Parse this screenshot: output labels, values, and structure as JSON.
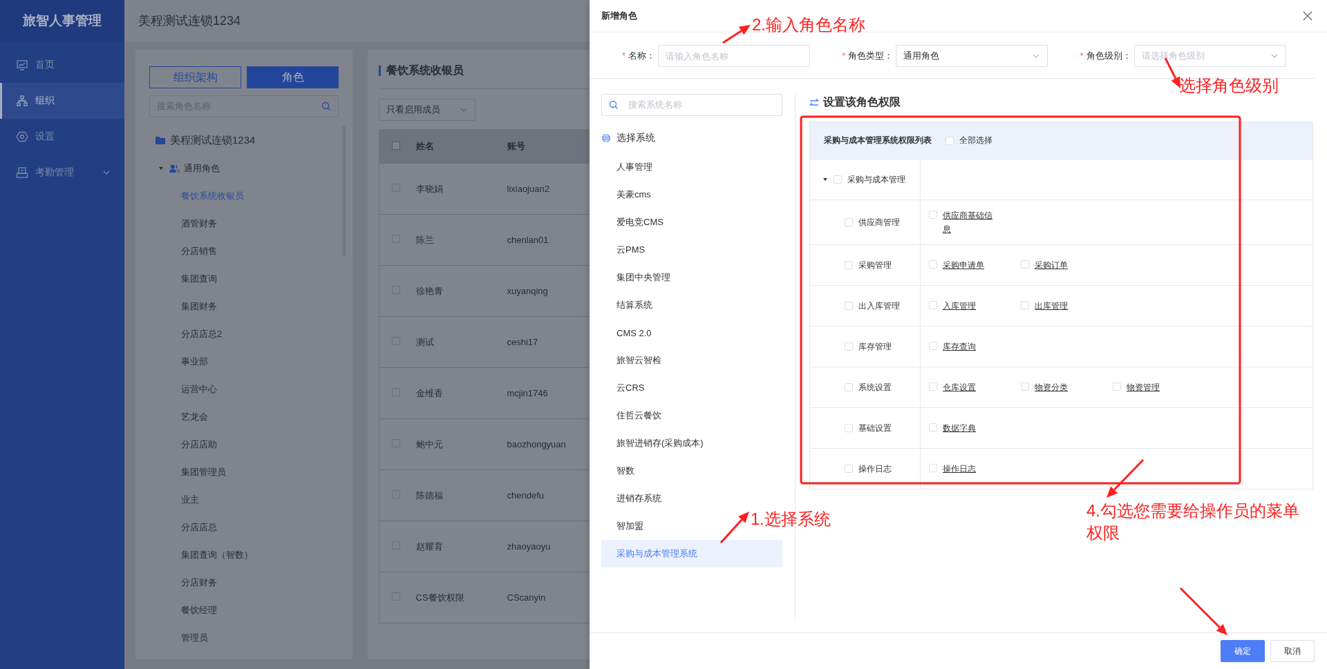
{
  "sidebar": {
    "logo": "旅智人事管理",
    "items": [
      {
        "label": "首页",
        "kind": "link",
        "selected": false
      },
      {
        "label": "组织",
        "kind": "link",
        "selected": true
      },
      {
        "label": "设置",
        "kind": "link",
        "selected": false
      },
      {
        "label": "考勤管理",
        "kind": "group",
        "selected": false
      }
    ]
  },
  "header": {
    "title": "美程测试连锁1234"
  },
  "org_panel": {
    "tabs": [
      {
        "label": "组织架构",
        "selected": false
      },
      {
        "label": "角色",
        "selected": true
      }
    ],
    "search": {
      "placeholder": "搜索角色名称"
    },
    "tree": {
      "label": "美程测试连锁1234",
      "children": [
        {
          "label": "通用角色",
          "expanded": true,
          "children": [
            {
              "label": "餐饮系统收银员",
              "selected": true
            },
            {
              "label": "酒管财务",
              "selected": false
            },
            {
              "label": "分店销售",
              "selected": false
            },
            {
              "label": "集团查询",
              "selected": false
            },
            {
              "label": "集团财务",
              "selected": false
            },
            {
              "label": "分店店总2",
              "selected": false
            },
            {
              "label": "事业部",
              "selected": false
            },
            {
              "label": "运营中心",
              "selected": false
            },
            {
              "label": "艺龙会",
              "selected": false
            },
            {
              "label": "分店店助",
              "selected": false
            },
            {
              "label": "集团管理员",
              "selected": false
            },
            {
              "label": "业主",
              "selected": false
            },
            {
              "label": "分店店总",
              "selected": false
            },
            {
              "label": "集团查询（智数）",
              "selected": false
            },
            {
              "label": "分店财务",
              "selected": false
            },
            {
              "label": "餐饮经理",
              "selected": false
            },
            {
              "label": "管理员",
              "selected": false
            }
          ]
        }
      ]
    }
  },
  "members_panel": {
    "title": "餐饮系统收银员",
    "filter": {
      "value": "只看启用成员"
    },
    "table": {
      "all_checked": false,
      "columns": [
        "姓名",
        "账号"
      ],
      "rows": [
        {
          "checked": false,
          "cells": [
            "李晓娟",
            "lixiaojuan2"
          ]
        },
        {
          "checked": false,
          "cells": [
            "陈兰",
            "chenlan01"
          ]
        },
        {
          "checked": false,
          "cells": [
            "徐艳青",
            "xuyanqing"
          ]
        },
        {
          "checked": false,
          "cells": [
            "测试",
            "ceshi17"
          ]
        },
        {
          "checked": false,
          "cells": [
            "金维香",
            "mcjin1746"
          ]
        },
        {
          "checked": false,
          "cells": [
            "鲍中元",
            "baozhongyuan"
          ]
        },
        {
          "checked": false,
          "cells": [
            "陈德福",
            "chendefu"
          ]
        },
        {
          "checked": false,
          "cells": [
            "赵耀育",
            "zhaoyaoyu"
          ]
        },
        {
          "checked": false,
          "cells": [
            "CS餐饮权限",
            "CScanyin"
          ]
        }
      ]
    }
  },
  "dialog": {
    "title": "新增角色",
    "form": [
      {
        "mark": "*",
        "label": "名称：",
        "kind": "input",
        "placeholder": "请输入角色名称"
      },
      {
        "mark": "*",
        "label": "角色类型：",
        "kind": "select",
        "value": "通用角色"
      },
      {
        "mark": "*",
        "label": "角色级别：",
        "kind": "select",
        "placeholder": "请选择角色级别"
      }
    ],
    "system_search": {
      "placeholder": "搜索系统名称"
    },
    "systems_heading": "选择系统",
    "systems": [
      {
        "label": "人事管理",
        "selected": false
      },
      {
        "label": "美豪cms",
        "selected": false
      },
      {
        "label": "爱电竞CMS",
        "selected": false
      },
      {
        "label": "云PMS",
        "selected": false
      },
      {
        "label": "集团中央管理",
        "selected": false
      },
      {
        "label": "结算系统",
        "selected": false
      },
      {
        "label": "CMS 2.0",
        "selected": false
      },
      {
        "label": "旅智云智检",
        "selected": false
      },
      {
        "label": "云CRS",
        "selected": false
      },
      {
        "label": "住哲云餐饮",
        "selected": false
      },
      {
        "label": "旅智进销存(采购成本)",
        "selected": false
      },
      {
        "label": "智数",
        "selected": false
      },
      {
        "label": "进销存系统",
        "selected": false
      },
      {
        "label": "智加盟",
        "selected": false
      },
      {
        "label": "采购与成本管理系统",
        "selected": true
      }
    ],
    "permissions": {
      "title": "设置该角色权限",
      "table_title": "采购与成本管理系统权限列表",
      "select_all": {
        "label": "全部选择",
        "checked": false
      },
      "root": {
        "label": "采购与成本管理",
        "checked": false,
        "expanded": true
      },
      "groups": [
        {
          "label": "供应商管理",
          "checked": false,
          "items": [
            {
              "label": "供应商基础信息",
              "checked": false
            }
          ]
        },
        {
          "label": "采购管理",
          "checked": false,
          "items": [
            {
              "label": "采购申请单",
              "checked": false
            },
            {
              "label": "采购订单",
              "checked": false
            }
          ]
        },
        {
          "label": "出入库管理",
          "checked": false,
          "items": [
            {
              "label": "入库管理",
              "checked": false
            },
            {
              "label": "出库管理",
              "checked": false
            }
          ]
        },
        {
          "label": "库存管理",
          "checked": false,
          "items": [
            {
              "label": "库存查询",
              "checked": false
            }
          ]
        },
        {
          "label": "系统设置",
          "checked": false,
          "items": [
            {
              "label": "仓库设置",
              "checked": false
            },
            {
              "label": "物资分类",
              "checked": false
            },
            {
              "label": "物资管理",
              "checked": false
            }
          ]
        },
        {
          "label": "基础设置",
          "checked": false,
          "items": [
            {
              "label": "数据字典",
              "checked": false
            }
          ]
        },
        {
          "label": "操作日志",
          "checked": false,
          "items": [
            {
              "label": "操作日志",
              "checked": false
            }
          ]
        }
      ]
    },
    "buttons": [
      {
        "label": "确定",
        "kind": "primary"
      },
      {
        "label": "取消",
        "kind": "default"
      }
    ]
  },
  "annotations": [
    {
      "text": "2.输入角色名称"
    },
    {
      "text": "选择角色级别"
    },
    {
      "text": "1.选择系统"
    },
    {
      "text": "4.勾选您需要给操作员的菜单权限"
    }
  ]
}
